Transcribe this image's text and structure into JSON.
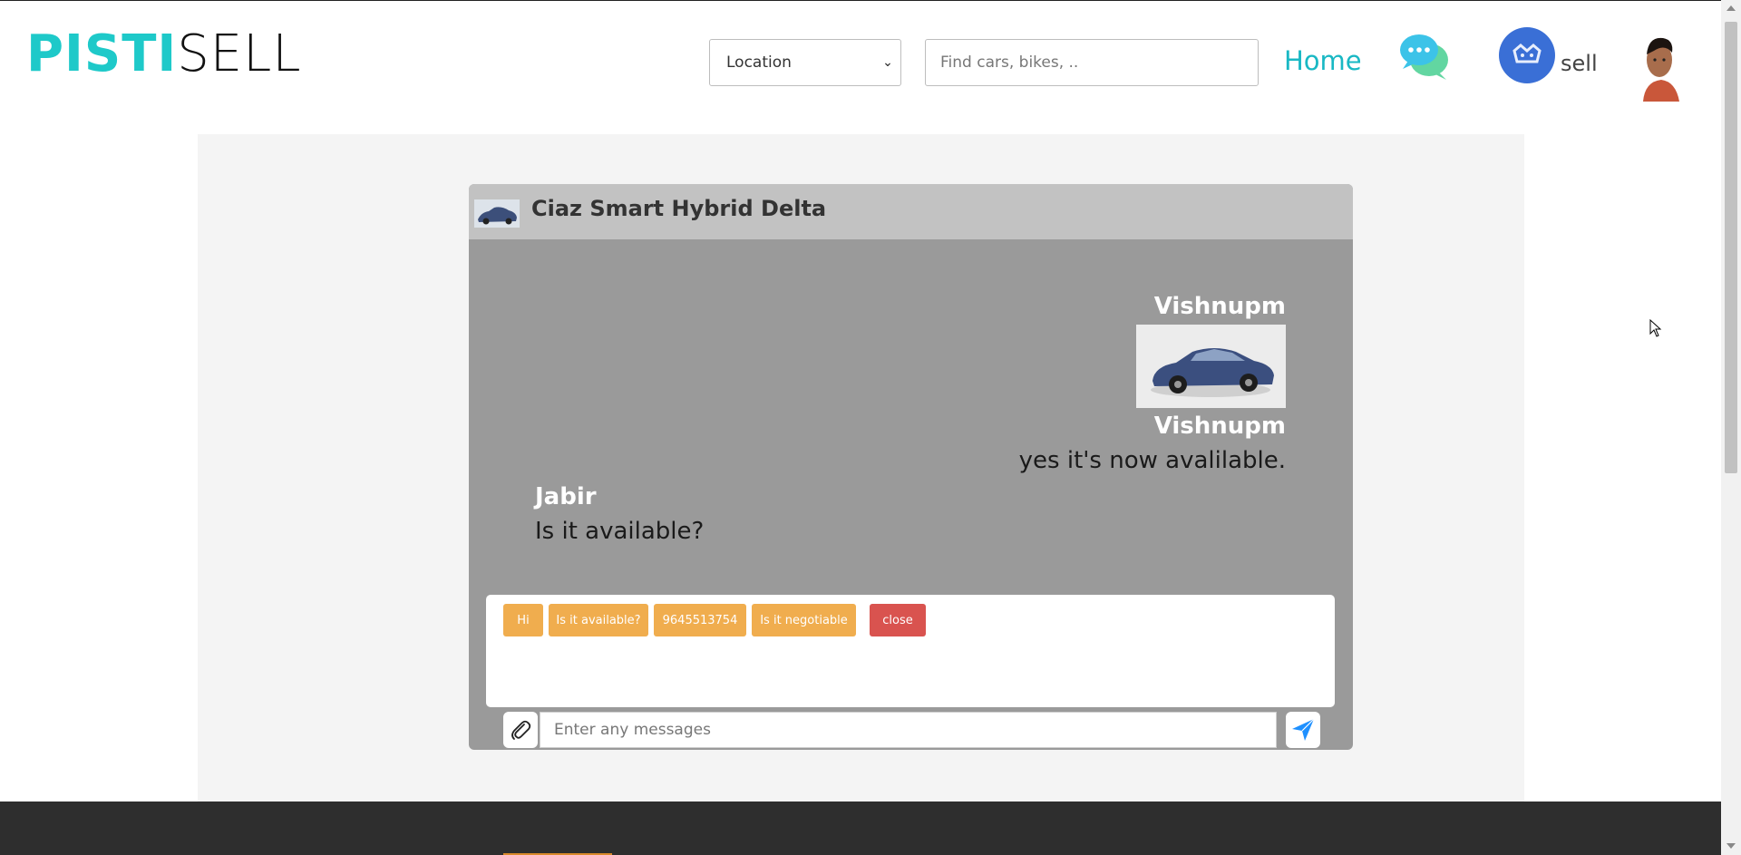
{
  "header": {
    "logo_part1": "PISTI",
    "logo_part2": "SELL",
    "location_select": {
      "selected": "Location"
    },
    "search": {
      "placeholder": "Find cars, bikes, .."
    },
    "nav_home": "Home",
    "sell_label": "sell",
    "icons": {
      "chat": "chat-bubbles-icon",
      "sell": "sell-logo-icon",
      "avatar": "user-avatar"
    }
  },
  "chat": {
    "title": "Ciaz Smart Hybrid Delta",
    "messages": [
      {
        "sender": "Vishnupm",
        "type": "image",
        "alt": "car photo"
      },
      {
        "sender": "Vishnupm",
        "type": "text",
        "text": "yes it's now avalilable."
      },
      {
        "sender": "Jabir",
        "type": "text",
        "text": "Is it available?"
      }
    ],
    "quick_replies": [
      "Hi",
      "Is it available?",
      "9645513754",
      "Is it negotiable"
    ],
    "close_label": "close",
    "input_placeholder": "Enter any messages",
    "icons": {
      "attach": "paperclip-icon",
      "send": "send-plane-icon"
    }
  },
  "colors": {
    "brand_teal": "#1ec9c9",
    "quick_reply": "#f0ad4e",
    "close": "#d9534f",
    "chat_bg": "#9a9a9a",
    "footer": "#2e2e2e"
  }
}
